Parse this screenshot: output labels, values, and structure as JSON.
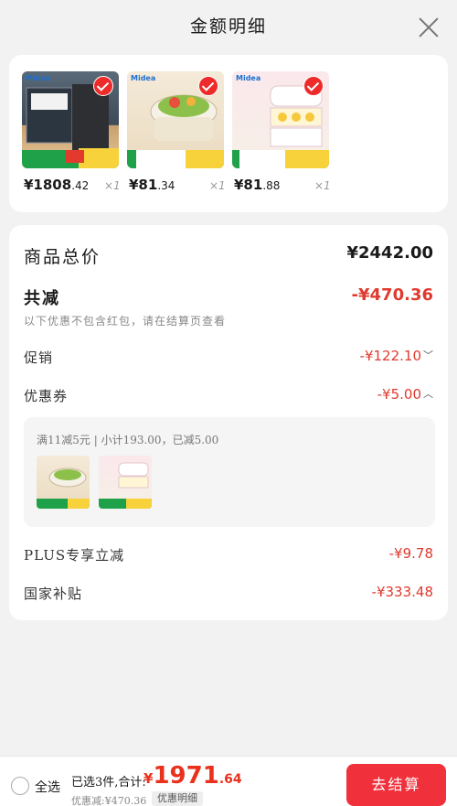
{
  "header": {
    "title": "金额明细"
  },
  "products": [
    {
      "brand": "Midea",
      "price_int": "¥1808",
      "price_dec": ".42",
      "qty": "×1"
    },
    {
      "brand": "Midea",
      "price_int": "¥81",
      "price_dec": ".34",
      "qty": "×1"
    },
    {
      "brand": "Midea",
      "price_int": "¥81",
      "price_dec": ".88",
      "qty": "×1"
    }
  ],
  "summary": {
    "total_label": "商品总价",
    "total_value": "¥2442.00",
    "discount_label": "共减",
    "discount_value": "-¥470.36",
    "note": "以下优惠不包含红包，请在结算页查看",
    "promo_label": "促销",
    "promo_value": "-¥122.10",
    "coupon_label": "优惠券",
    "coupon_value": "-¥5.00",
    "coupon_desc": "满11减5元 | 小计193.00，已减5.00",
    "plus_label": "PLUS专享立减",
    "plus_value": "-¥9.78",
    "subsidy_label": "国家补贴",
    "subsidy_value": "-¥333.48"
  },
  "footer": {
    "select_all": "全选",
    "selected_text": "已选3件,合计:",
    "currency": "¥",
    "total_int": "1971",
    "total_dec": ".64",
    "saved_text": "优惠减:¥470.36",
    "detail_label": "优惠明细",
    "checkout_label": "去结算"
  },
  "colors": {
    "accent": "#f0313c",
    "price_red": "#e03a2f"
  },
  "icons": {
    "close": "close-icon",
    "check": "check-icon",
    "chevron_down": "chevron-down-icon",
    "chevron_up": "chevron-up-icon"
  }
}
